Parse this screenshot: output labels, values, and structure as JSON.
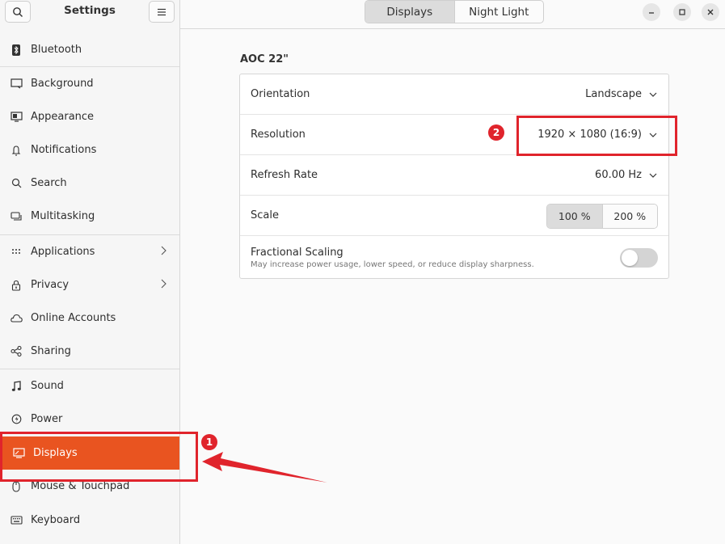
{
  "app": {
    "title": "Settings"
  },
  "header": {
    "tabs": [
      {
        "label": "Displays",
        "active": true
      },
      {
        "label": "Night Light",
        "active": false
      }
    ],
    "window_controls": [
      "minimize-icon",
      "maximize-icon",
      "close-icon"
    ]
  },
  "sidebar": {
    "items": [
      {
        "label": "Bluetooth",
        "icon": "bluetooth-icon"
      },
      {
        "label": "Background",
        "icon": "background-icon"
      },
      {
        "label": "Appearance",
        "icon": "appearance-icon"
      },
      {
        "label": "Notifications",
        "icon": "bell-icon"
      },
      {
        "label": "Search",
        "icon": "search-icon"
      },
      {
        "label": "Multitasking",
        "icon": "multitasking-icon"
      },
      {
        "label": "Applications",
        "icon": "grid-icon",
        "has_submenu": true
      },
      {
        "label": "Privacy",
        "icon": "lock-icon",
        "has_submenu": true
      },
      {
        "label": "Online Accounts",
        "icon": "cloud-icon"
      },
      {
        "label": "Sharing",
        "icon": "share-icon"
      },
      {
        "label": "Sound",
        "icon": "music-note-icon"
      },
      {
        "label": "Power",
        "icon": "power-icon"
      },
      {
        "label": "Displays",
        "icon": "display-icon",
        "selected": true
      },
      {
        "label": "Mouse & Touchpad",
        "icon": "mouse-icon"
      },
      {
        "label": "Keyboard",
        "icon": "keyboard-icon"
      }
    ],
    "selected_color": "#e95420"
  },
  "display": {
    "monitor_name": "AOC 22\"",
    "orientation": {
      "label": "Orientation",
      "value": "Landscape"
    },
    "resolution": {
      "label": "Resolution",
      "value": "1920 × 1080 (16:9)"
    },
    "refresh_rate": {
      "label": "Refresh Rate",
      "value": "60.00 Hz"
    },
    "scale": {
      "label": "Scale",
      "options": [
        "100 %",
        "200 %"
      ],
      "selected": "100 %"
    },
    "fractional_scaling": {
      "label": "Fractional Scaling",
      "description": "May increase power usage, lower speed, or reduce display sharpness.",
      "enabled": false
    }
  },
  "annotations": {
    "badge_1": "1",
    "badge_2": "2",
    "color": "#e0242c"
  }
}
